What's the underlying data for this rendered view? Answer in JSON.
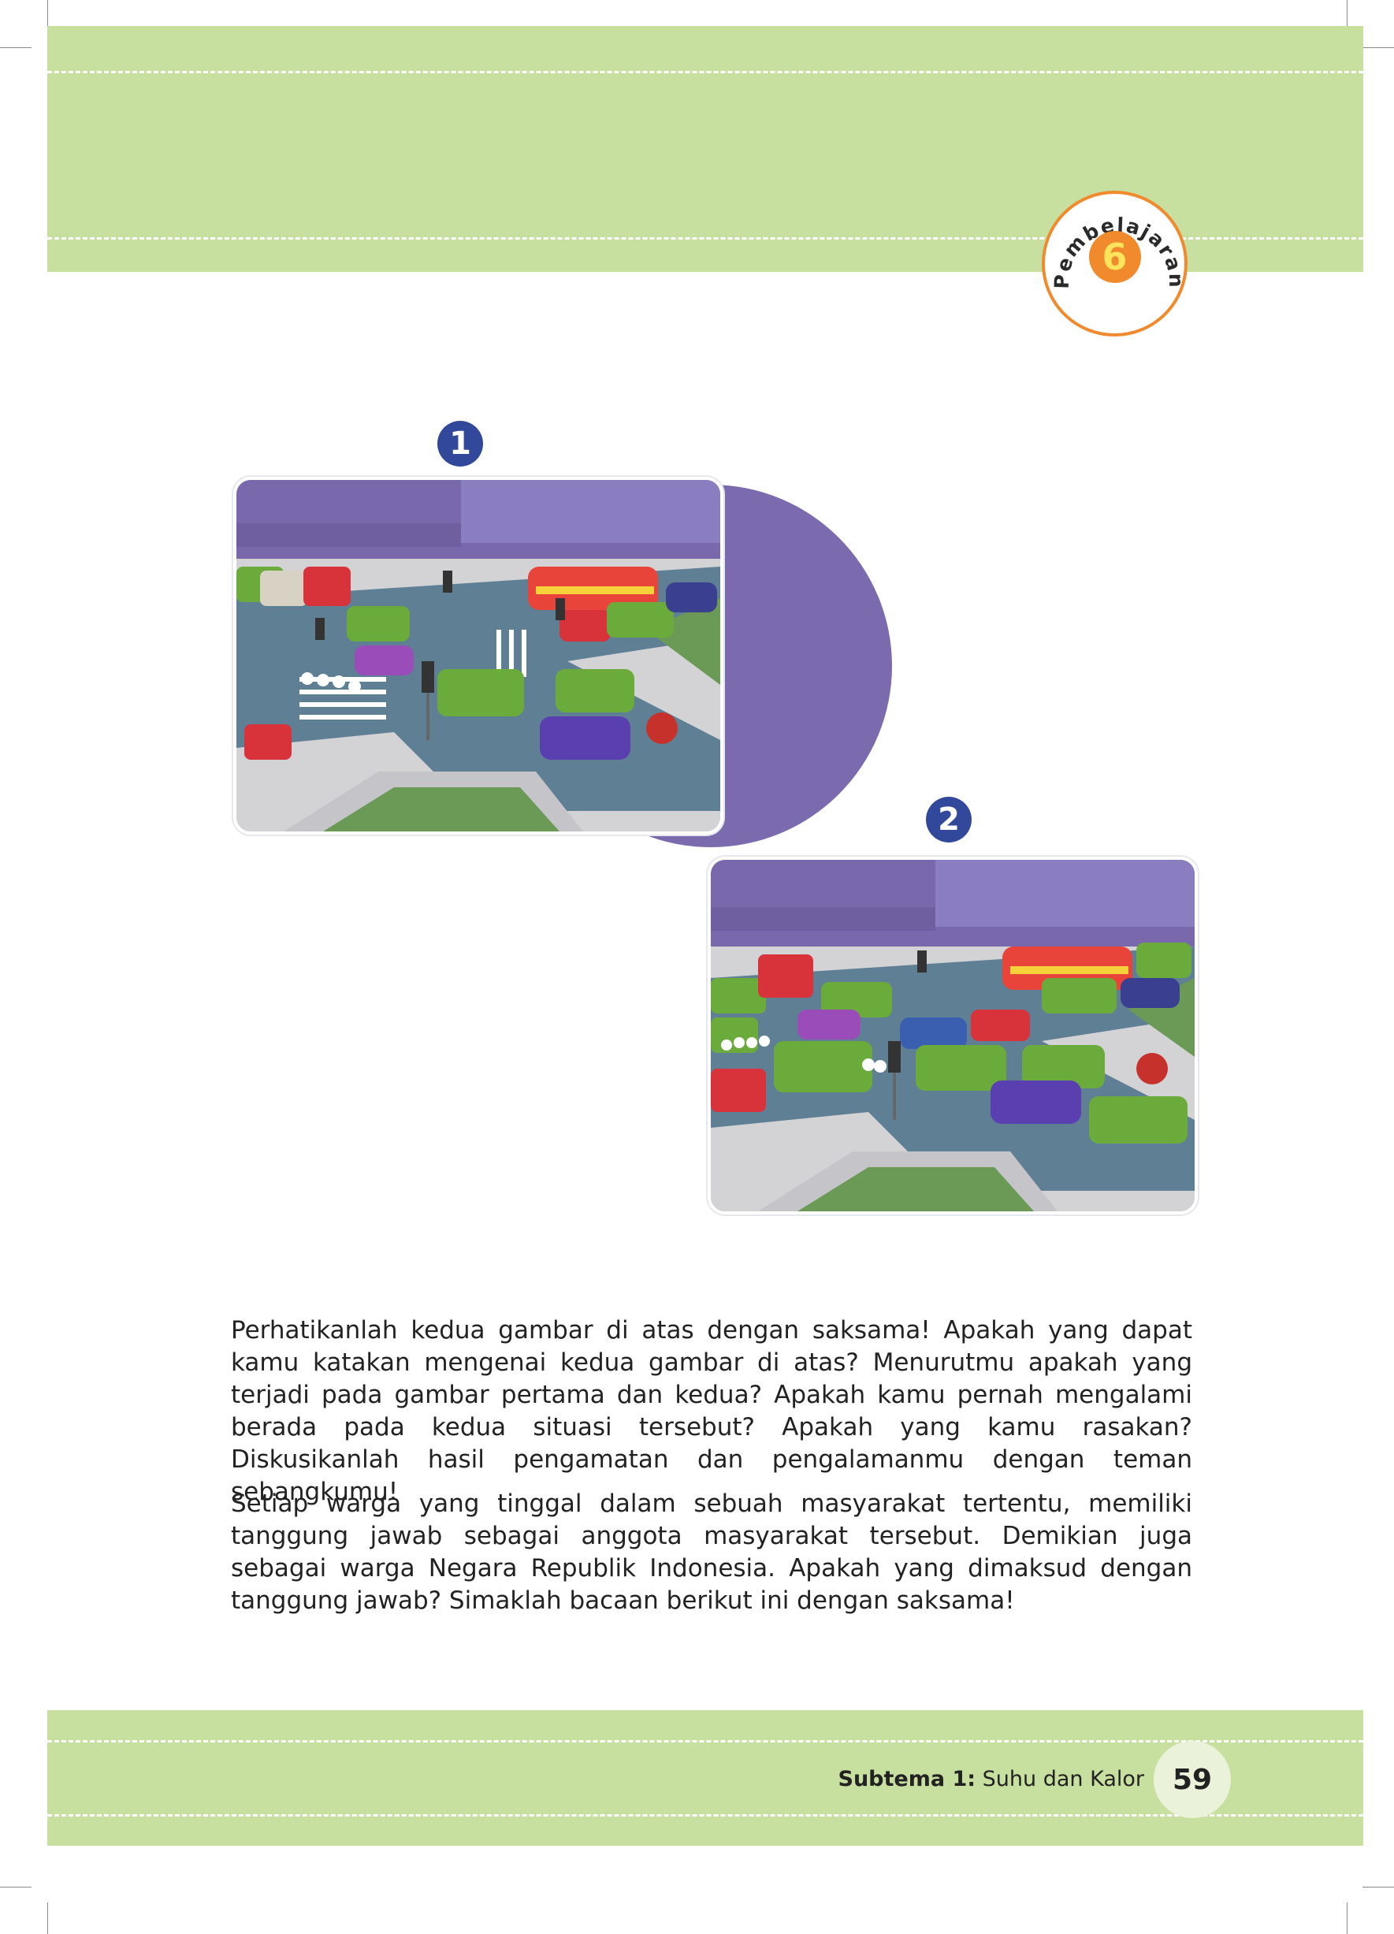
{
  "colors": {
    "band": "#c8e09f",
    "badge_accent": "#f08a2c",
    "marker": "#32489a",
    "deco": "#7b6aad"
  },
  "badge": {
    "word": "Pembelajaran",
    "number": "6"
  },
  "figures": [
    {
      "marker": "1"
    },
    {
      "marker": "2"
    }
  ],
  "paragraphs": [
    "Perhatikanlah kedua gambar di atas dengan saksama! Apakah yang dapat kamu katakan mengenai kedua gambar di atas? Menurutmu apakah yang terjadi pada gambar pertama dan kedua? Apakah kamu pernah mengalami berada pada kedua situasi tersebut? Apakah yang kamu rasakan? Diskusikanlah hasil pengamatan dan pengalamanmu dengan teman sebangkumu!",
    "Setiap warga yang tinggal dalam sebuah masyarakat tertentu, memiliki tanggung jawab sebagai anggota masyarakat tersebut. Demikian juga sebagai warga Negara Republik Indonesia. Apakah yang dimaksud dengan tanggung jawab? Simaklah bacaan berikut ini dengan saksama!"
  ],
  "footer": {
    "subtema_label": "Subtema 1:",
    "subtema_title": "Suhu dan Kalor",
    "page_number": "59"
  }
}
